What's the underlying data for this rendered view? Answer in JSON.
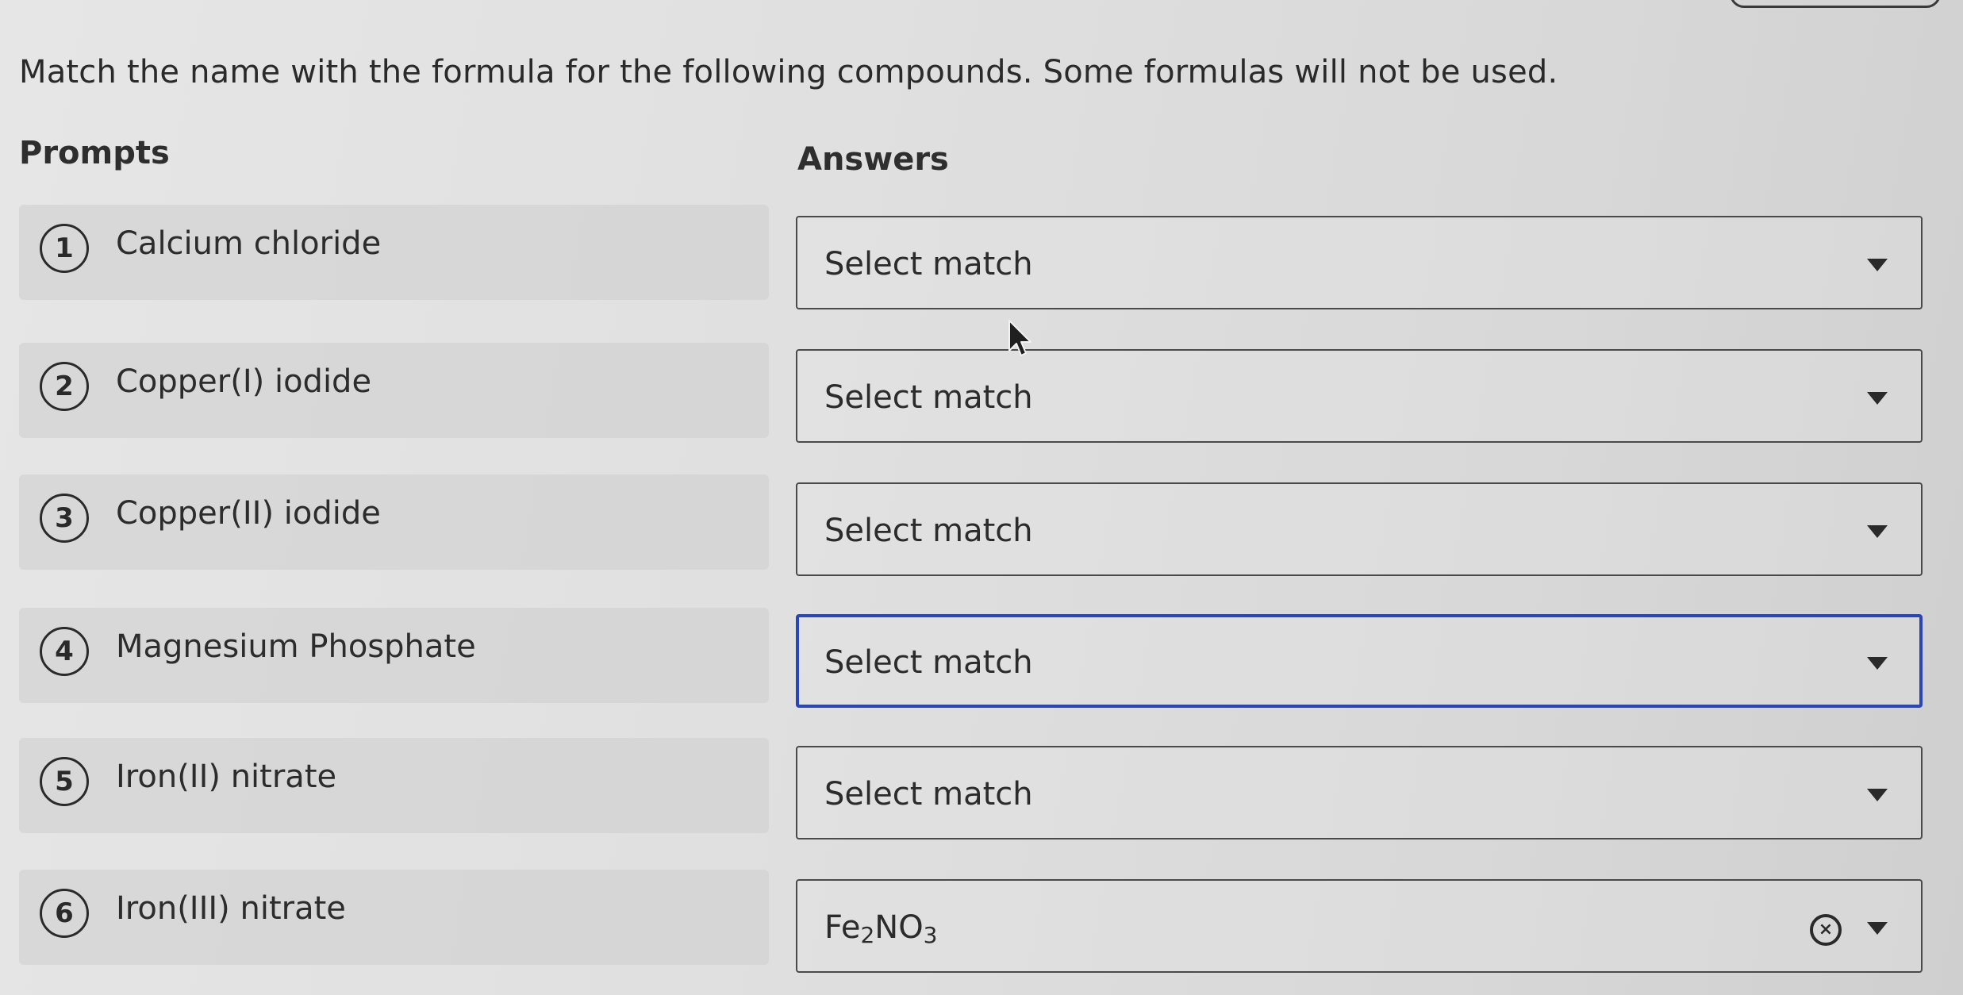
{
  "instructions": "Match the name with the formula for the following compounds. Some formulas will not be used.",
  "headings": {
    "prompts": "Prompts",
    "answers": "Answers"
  },
  "rows": [
    {
      "number": "1",
      "prompt": "Calcium chloride",
      "answer": "Select match"
    },
    {
      "number": "2",
      "prompt": "Copper(I) iodide",
      "answer": "Select match"
    },
    {
      "number": "3",
      "prompt": "Copper(II) iodide",
      "answer": "Select match"
    },
    {
      "number": "4",
      "prompt": "Magnesium Phosphate",
      "answer": "Select match",
      "focused": true
    },
    {
      "number": "5",
      "prompt": "Iron(II) nitrate",
      "answer": "Select match"
    },
    {
      "number": "6",
      "prompt": "Iron(III) nitrate",
      "answer_formula": {
        "el1": "Fe",
        "sub1": "2",
        "el2": "NO",
        "sub2": "3"
      }
    }
  ],
  "icons": {
    "caret": "chevron-down-icon",
    "clear": "clear-circle-x-icon",
    "pointer": "mouse-pointer-icon"
  },
  "colors": {
    "focus_border": "#2a45b8",
    "text": "#2b2b2b"
  }
}
